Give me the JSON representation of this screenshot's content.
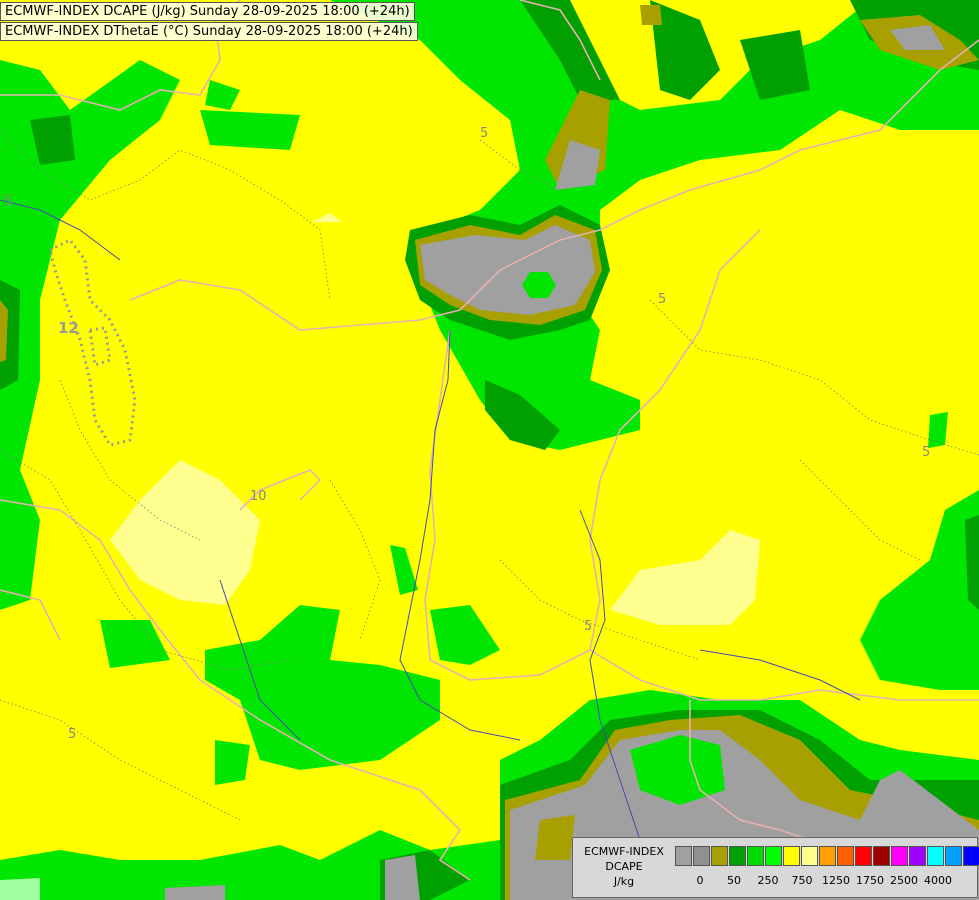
{
  "titles": {
    "line1": "ECMWF-INDEX DCAPE (J/kg) Sunday 28-09-2025 18:00 (+24h)",
    "line2": "ECMWF-INDEX DThetaE (°C) Sunday 28-09-2025 18:00 (+24h)"
  },
  "legend": {
    "product": "ECMWF-INDEX",
    "variable": "DCAPE",
    "unit": "J/kg",
    "colors": [
      "#a0a0a0",
      "#909090",
      "#a8a000",
      "#00a000",
      "#00dc00",
      "#00ff00",
      "#ffff00",
      "#ffff90",
      "#ffa000",
      "#ff6000",
      "#ff0000",
      "#a00000",
      "#ff00ff",
      "#a000ff",
      "#00ffff",
      "#00a0ff",
      "#0000ff",
      "#00008c"
    ],
    "ticks": [
      {
        "label": "0",
        "at": 1
      },
      {
        "label": "50",
        "at": 3
      },
      {
        "label": "250",
        "at": 5
      },
      {
        "label": "750",
        "at": 7
      },
      {
        "label": "1250",
        "at": 9
      },
      {
        "label": "1750",
        "at": 11
      },
      {
        "label": "2500",
        "at": 13
      },
      {
        "label": "4000",
        "at": 15
      }
    ]
  },
  "contours": {
    "labels": [
      {
        "text": "5"
      },
      {
        "text": "5"
      },
      {
        "text": "5"
      },
      {
        "text": "5"
      },
      {
        "text": "5"
      },
      {
        "text": "10"
      },
      {
        "text": "12"
      },
      {
        "text": "5"
      }
    ]
  }
}
